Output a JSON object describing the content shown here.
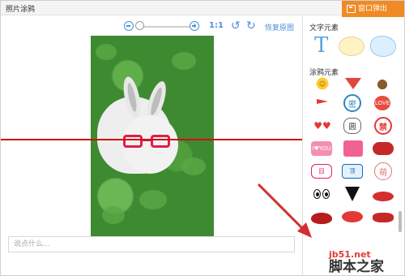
{
  "window": {
    "title": "照片涂鸦",
    "popout_label": "窗口弹出"
  },
  "toolbar": {
    "zoom_level": "1:1",
    "restore_label": "恢复原图"
  },
  "comment": {
    "placeholder": "说点什么..."
  },
  "panel": {
    "text_section_title": "文字元素",
    "text_tool": "T",
    "doodle_section_title": "涂鸦元素",
    "stickers": {
      "mi": "密",
      "love": "LOVE",
      "panda": "圆",
      "ban": "禁",
      "i_love_you": "I♥YOU",
      "ding": "顶",
      "cute": "萌",
      "jiong": "囧"
    }
  },
  "watermark": {
    "site": "jb51.net",
    "logo": "脚本之家"
  },
  "colors": {
    "accent": "#4a90d9",
    "popout": "#f08a24",
    "glasses": "#e11d48",
    "red_line": "#d01010"
  }
}
